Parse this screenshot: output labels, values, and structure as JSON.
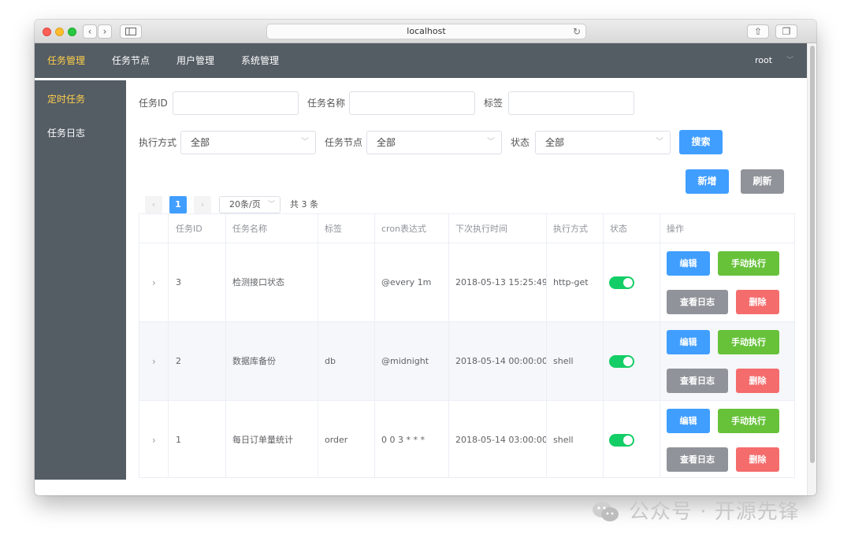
{
  "browser": {
    "url": "localhost"
  },
  "nav": {
    "items": [
      {
        "label": "任务管理",
        "active": true
      },
      {
        "label": "任务节点",
        "active": false
      },
      {
        "label": "用户管理",
        "active": false
      },
      {
        "label": "系统管理",
        "active": false
      }
    ],
    "user": "root"
  },
  "sidebar": {
    "items": [
      {
        "label": "定时任务",
        "active": true
      },
      {
        "label": "任务日志",
        "active": false
      }
    ]
  },
  "filters": {
    "task_id_label": "任务ID",
    "task_id_value": "",
    "task_name_label": "任务名称",
    "task_name_value": "",
    "tag_label": "标签",
    "tag_value": "",
    "exec_mode_label": "执行方式",
    "exec_mode_value": "全部",
    "task_node_label": "任务节点",
    "task_node_value": "全部",
    "status_label": "状态",
    "status_value": "全部",
    "search_label": "搜索"
  },
  "actions": {
    "add_label": "新增",
    "refresh_label": "刷新"
  },
  "pagination": {
    "prev": "‹",
    "current": "1",
    "next": "›",
    "page_size": "20条/页",
    "total": "共 3 条"
  },
  "table": {
    "headers": [
      "任务ID",
      "任务名称",
      "标签",
      "cron表达式",
      "下次执行时间",
      "执行方式",
      "状态",
      "操作"
    ],
    "row_buttons": {
      "edit": "编辑",
      "run": "手动执行",
      "logs": "查看日志",
      "delete": "删除"
    },
    "rows": [
      {
        "id": "3",
        "name": "检测接口状态",
        "tag": "",
        "cron": "@every 1m",
        "next_run": "2018-05-13 15:25:49",
        "mode": "http-get",
        "enabled": true
      },
      {
        "id": "2",
        "name": "数据库备份",
        "tag": "db",
        "cron": "@midnight",
        "next_run": "2018-05-14 00:00:00",
        "mode": "shell",
        "enabled": true
      },
      {
        "id": "1",
        "name": "每日订单量统计",
        "tag": "order",
        "cron": "0 0 3 * * *",
        "next_run": "2018-05-14 03:00:00",
        "mode": "shell",
        "enabled": true
      }
    ]
  },
  "watermark": {
    "text": "公众号 · 开源先锋"
  },
  "colors": {
    "nav_bg": "#545c64",
    "nav_active": "#ffd04b",
    "primary": "#409eff",
    "success": "#67c23a",
    "danger": "#f56c6c",
    "info": "#909399",
    "switch_on": "#13ce66"
  }
}
